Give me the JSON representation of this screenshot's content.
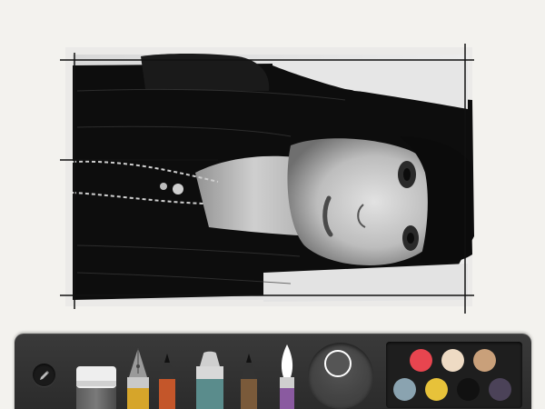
{
  "app": {
    "canvas": {
      "description_icon": "portrait-sketch"
    }
  },
  "toolbar": {
    "settings_icon": "pencil-icon",
    "tools": [
      {
        "name": "eraser",
        "color": "#e8e8e8"
      },
      {
        "name": "fountain-pen",
        "color": "#d6a52a"
      },
      {
        "name": "pencil",
        "color": "#c4562a"
      },
      {
        "name": "marker",
        "color": "#5a8c8c"
      },
      {
        "name": "outline-pencil",
        "color": "#7a5a3a"
      },
      {
        "name": "brush",
        "color": "#8a5aa0"
      }
    ],
    "mixer": {
      "selected_color": "#555555"
    },
    "palette": [
      "#e8454f",
      "#eedbc4",
      "#c9a07a",
      "#8aa3b0",
      "#e7c23a",
      "#111111",
      "#4b4258"
    ]
  }
}
